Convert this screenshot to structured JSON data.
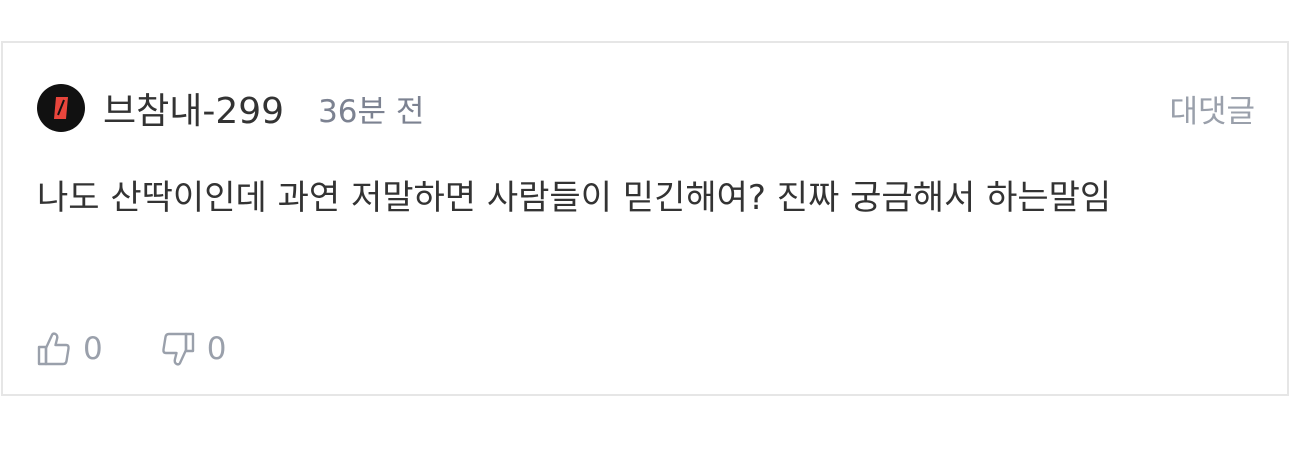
{
  "comment": {
    "author": "브참내-299",
    "time": "36분 전",
    "reply_label": "대댓글",
    "text": "나도 산딱이인데 과연 저말하면 사람들이 믿긴해여? 진짜 궁금해서 하는말임",
    "likes": "0",
    "dislikes": "0"
  },
  "colors": {
    "avatar_bg": "#111111",
    "avatar_accent": "#e8453c",
    "border": "#e6e6e6",
    "muted_text": "#9aa0ab",
    "body_text": "#333333"
  },
  "icons": {
    "like": "thumbs-up-icon",
    "dislike": "thumbs-down-icon",
    "avatar": "user-avatar"
  }
}
